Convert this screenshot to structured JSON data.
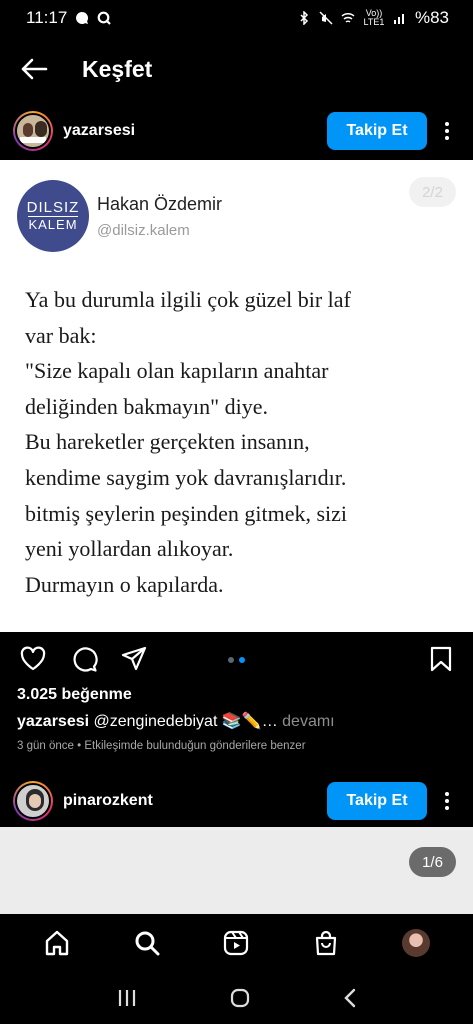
{
  "status_bar": {
    "time": "11:17",
    "left_icons": [
      "chat-bubble-icon",
      "q-app-icon"
    ],
    "right_icons": [
      "bluetooth-icon",
      "mute-icon",
      "wifi-icon",
      "volte-icon",
      "signal-icon"
    ],
    "volte_label": "Vo)) LTE1",
    "battery": "%83"
  },
  "topbar": {
    "title": "Keşfet"
  },
  "post1": {
    "username": "yazarsesi",
    "follow_label": "Takip Et",
    "image": {
      "avatar_line1": "DILSIZ",
      "avatar_line2": "KALEM",
      "author_name": "Hakan Özdemir",
      "author_handle": "@dilsiz.kalem",
      "page_counter": "2/2",
      "lines": [
        "Ya bu durumla ilgili çok güzel bir laf",
        "var bak:",
        "\"Size kapalı olan kapıların anahtar",
        "deliğinden bakmayın\" diye.",
        "Bu hareketler gerçekten insanın,",
        "kendime saygim yok davranışlarıdır.",
        "bitmiş şeylerin peşinden gitmek, sizi",
        "yeni yollardan alıkoyar.",
        "Durmayın o kapılarda."
      ]
    },
    "carousel": {
      "count": 2,
      "active_index": 1
    },
    "likes": "3.025 beğenme",
    "caption_user": "yazarsesi",
    "caption_text": "@zenginedebiyat 📚✏️…",
    "caption_more": "devamı",
    "meta": "3 gün önce • Etkileşimde bulunduğun gönderilere benzer"
  },
  "post2": {
    "username": "pinarozkent",
    "follow_label": "Takip Et",
    "page_counter": "1/6"
  },
  "bottom_nav": [
    "home-icon",
    "search-icon",
    "reels-icon",
    "shop-icon",
    "profile-avatar"
  ],
  "system_nav": [
    "recents-icon",
    "home-circle-icon",
    "back-chevron-icon"
  ],
  "colors": {
    "accent": "#0095f6",
    "background": "#000000",
    "avatar_navy": "#3f4b8c"
  }
}
